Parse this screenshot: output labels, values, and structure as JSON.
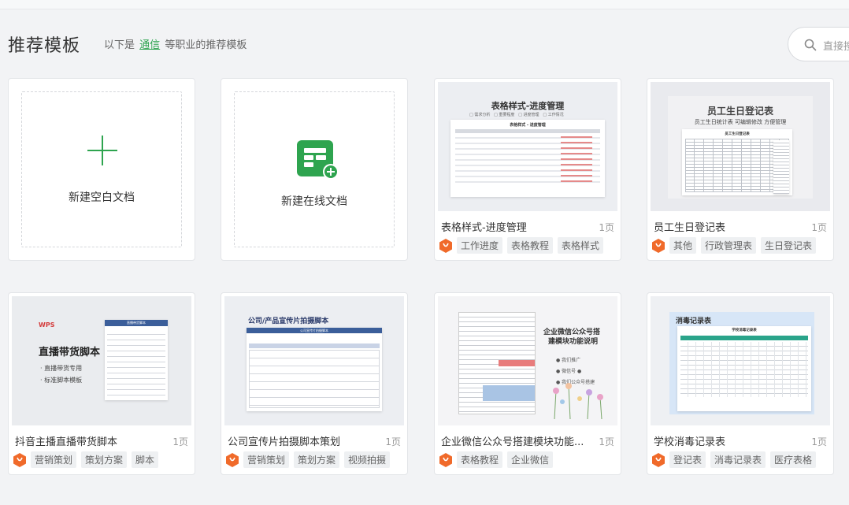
{
  "header": {
    "title": "推荐模板",
    "subtitle_prefix": "以下是",
    "subtitle_highlight": "通信",
    "subtitle_suffix": "等职业的推荐模板"
  },
  "search": {
    "placeholder": "直接搜"
  },
  "new_blank": {
    "label": "新建空白文档"
  },
  "new_online": {
    "label": "新建在线文档"
  },
  "templates": [
    {
      "name": "表格样式-进度管理",
      "pages": "1页",
      "tags": [
        "工作进度",
        "表格教程",
        "表格样式"
      ],
      "thumb": {
        "title": "表格样式-进度管理",
        "subtitle": "表格样式 - 进度管理",
        "legend": [
          "□ 需求分析",
          "□ 重要程度",
          "□ 进度管理",
          "□ 工作情况"
        ]
      }
    },
    {
      "name": "员工生日登记表",
      "pages": "1页",
      "tags": [
        "其他",
        "行政管理表",
        "生日登记表"
      ],
      "thumb": {
        "title": "员工生日登记表",
        "subtitle": "员工生日统计表 可编辑修改 方便管理",
        "sheet_title": "员工生日登记表"
      }
    },
    {
      "name": "抖音主播直播带货脚本",
      "pages": "1页",
      "tags": [
        "营销策划",
        "策划方案",
        "脚本"
      ],
      "thumb": {
        "logo": "WPS",
        "title": "直播带货脚本",
        "bullets": [
          "· 直播带货专用",
          "· 标准脚本模板"
        ],
        "sheet_title": "直播带货脚本"
      }
    },
    {
      "name": "公司宣传片拍摄脚本策划",
      "pages": "1页",
      "tags": [
        "营销策划",
        "策划方案",
        "视频拍摄"
      ],
      "thumb": {
        "title": "公司/产品宣传片拍摄脚本",
        "sheet_title": "公司宣传片拍摄脚本"
      }
    },
    {
      "name": "企业微信公众号搭建模块功能...",
      "pages": "1页",
      "tags": [
        "表格教程",
        "企业微信"
      ],
      "thumb": {
        "title_line1": "企业微信公众号搭",
        "title_line2": "建模块功能说明",
        "bullets": [
          "● 我们推广",
          "● 微信号 ●",
          "● 我们公众号搭建"
        ]
      }
    },
    {
      "name": "学校消毒记录表",
      "pages": "1页",
      "tags": [
        "登记表",
        "消毒记录表",
        "医疗表格"
      ],
      "thumb": {
        "title": "消毒记录表",
        "sheet_title": "学校消毒记录表"
      }
    }
  ],
  "colors": {
    "accent": "#2ea44f",
    "badge": "#f06a2a",
    "table_head_blue": "#3b5e9a",
    "table_head_teal": "#2aa48a"
  }
}
